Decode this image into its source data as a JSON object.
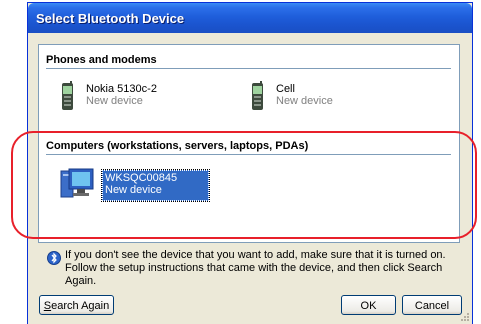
{
  "window": {
    "title": "Select Bluetooth Device"
  },
  "groups": [
    {
      "header": "Phones and modems",
      "devices": [
        {
          "name": "Nokia 5130c-2",
          "status": "New device",
          "icon": "phone-icon"
        },
        {
          "name": "Cell",
          "status": "New device",
          "icon": "phone-icon"
        }
      ]
    },
    {
      "header": "Computers (workstations, servers, laptops, PDAs)",
      "devices": [
        {
          "name": "WKSQC00845",
          "status": "New device",
          "icon": "computer-icon",
          "selected": true
        }
      ]
    }
  ],
  "info": {
    "icon": "bluetooth-info-icon",
    "text": "If you don't see the device that you want to add, make sure that it is turned on. Follow the setup instructions that came with the device, and then click Search Again."
  },
  "buttons": {
    "search_again": {
      "accesskey": "S",
      "rest": "earch Again"
    },
    "ok": "OK",
    "cancel": "Cancel"
  },
  "colors": {
    "title_bar": "#1F5EDB",
    "selection": "#316AC5",
    "annotation": "#E8202A",
    "window_bg": "#ECE9D8"
  }
}
